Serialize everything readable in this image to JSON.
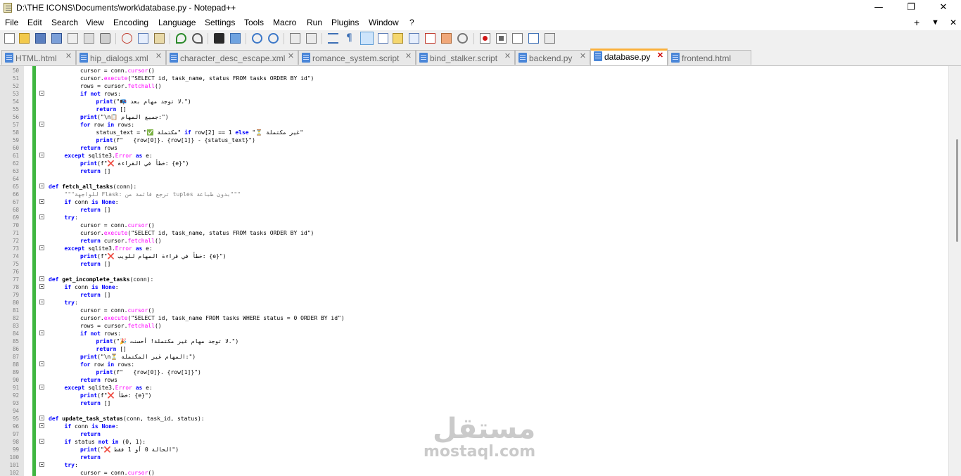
{
  "window": {
    "title": "D:\\THE ICONS\\Documents\\work\\database.py - Notepad++",
    "controls": {
      "minimize": "—",
      "maximize": "❐",
      "close": "✕"
    }
  },
  "menu": {
    "items": [
      "File",
      "Edit",
      "Search",
      "View",
      "Encoding",
      "Language",
      "Settings",
      "Tools",
      "Macro",
      "Run",
      "Plugins",
      "Window",
      "?"
    ],
    "right": {
      "plus": "+",
      "dropdown": "▼",
      "close": "✕"
    }
  },
  "toolbar": {
    "icons": [
      "new-file-icon",
      "open-file-icon",
      "save-icon",
      "save-all-icon",
      "close-icon",
      "close-all-icon",
      "print-icon",
      "cut-icon",
      "copy-icon",
      "paste-icon",
      "undo-icon",
      "redo-icon",
      "find-icon",
      "replace-icon",
      "zoom-in-icon",
      "zoom-out-icon",
      "sync-vertical-icon",
      "sync-horizontal-icon",
      "word-wrap-icon",
      "show-all-chars-icon",
      "indent-guide-icon",
      "doc-map-icon",
      "function-list-icon",
      "folder-workspace-icon",
      "monitor-icon",
      "record-macro-icon",
      "stop-macro-icon",
      "play-macro-icon",
      "run-macro-multiple-icon",
      "save-macro-icon"
    ]
  },
  "tabs": [
    {
      "label": "HTML.html",
      "active": false
    },
    {
      "label": "hip_dialogs.xml",
      "active": false
    },
    {
      "label": "character_desc_escape.xml",
      "active": false
    },
    {
      "label": "romance_system.script",
      "active": false
    },
    {
      "label": "bind_stalker.script",
      "active": false
    },
    {
      "label": "backend.py",
      "active": false
    },
    {
      "label": "database.py",
      "active": true
    },
    {
      "label": "frontend.html",
      "active": false
    }
  ],
  "editor": {
    "lines": [
      {
        "n": "50",
        "fold": false,
        "indent": 2,
        "tokens": [
          [
            "",
            "cursor = conn."
          ],
          [
            "fn",
            "cursor"
          ],
          [
            "",
            "()"
          ]
        ]
      },
      {
        "n": "51",
        "fold": false,
        "indent": 2,
        "tokens": [
          [
            "",
            "cursor."
          ],
          [
            "fn",
            "execute"
          ],
          [
            "",
            "(\"SELECT id, task_name, status FROM tasks ORDER BY id\")"
          ]
        ]
      },
      {
        "n": "52",
        "fold": false,
        "indent": 2,
        "tokens": [
          [
            "",
            "rows = cursor."
          ],
          [
            "fn",
            "fetchall"
          ],
          [
            "",
            "()"
          ]
        ]
      },
      {
        "n": "53",
        "fold": true,
        "indent": 2,
        "tokens": [
          [
            "kw",
            "if not"
          ],
          [
            "",
            " rows:"
          ]
        ]
      },
      {
        "n": "54",
        "fold": false,
        "indent": 3,
        "tokens": [
          [
            "kw",
            "print"
          ],
          [
            "",
            "(\"📭 لا توجد مهام بعد.\")"
          ]
        ]
      },
      {
        "n": "55",
        "fold": false,
        "indent": 3,
        "tokens": [
          [
            "kw",
            "return"
          ],
          [
            "",
            " []"
          ]
        ]
      },
      {
        "n": "56",
        "fold": false,
        "indent": 2,
        "tokens": [
          [
            "kw",
            "print"
          ],
          [
            "",
            "(\"\\n📋 جميع المهام:\")"
          ]
        ]
      },
      {
        "n": "57",
        "fold": true,
        "indent": 2,
        "tokens": [
          [
            "kw",
            "for"
          ],
          [
            "",
            " row "
          ],
          [
            "kw",
            "in"
          ],
          [
            "",
            " rows:"
          ]
        ]
      },
      {
        "n": "58",
        "fold": false,
        "indent": 3,
        "tokens": [
          [
            "",
            "status_text = \"✅ مكتملة\" "
          ],
          [
            "kw",
            "if"
          ],
          [
            "",
            " row[2] == 1 "
          ],
          [
            "kw",
            "else"
          ],
          [
            "",
            " \"⏳ غير مكتملة\""
          ]
        ]
      },
      {
        "n": "59",
        "fold": false,
        "indent": 3,
        "tokens": [
          [
            "kw",
            "print"
          ],
          [
            "",
            "(f\"   {row[0]}. {row[1]} - {status_text}\")"
          ]
        ]
      },
      {
        "n": "60",
        "fold": false,
        "indent": 2,
        "tokens": [
          [
            "kw",
            "return"
          ],
          [
            "",
            " rows"
          ]
        ]
      },
      {
        "n": "61",
        "fold": true,
        "indent": 1,
        "tokens": [
          [
            "kw",
            "except"
          ],
          [
            "",
            " sqlite3."
          ],
          [
            "fn",
            "Error"
          ],
          [
            "",
            " "
          ],
          [
            "kw",
            "as"
          ],
          [
            "",
            " e:"
          ]
        ]
      },
      {
        "n": "62",
        "fold": false,
        "indent": 2,
        "tokens": [
          [
            "kw",
            "print"
          ],
          [
            "",
            "(f\"❌ خطأ في القراءة: {e}\")"
          ]
        ]
      },
      {
        "n": "63",
        "fold": false,
        "indent": 2,
        "tokens": [
          [
            "kw",
            "return"
          ],
          [
            "",
            " []"
          ]
        ]
      },
      {
        "n": "64",
        "fold": false,
        "indent": 0,
        "tokens": []
      },
      {
        "n": "65",
        "fold": true,
        "indent": 0,
        "tokens": [
          [
            "kw",
            "def"
          ],
          [
            "",
            " "
          ],
          [
            "fdef",
            "fetch_all_tasks"
          ],
          [
            "",
            "(conn):"
          ]
        ]
      },
      {
        "n": "66",
        "fold": false,
        "indent": 1,
        "tokens": [
          [
            "str",
            "\"\"\"للواجهة Flask: ترجع قائمة من tuples بدون طباعة\"\"\""
          ]
        ]
      },
      {
        "n": "67",
        "fold": true,
        "indent": 1,
        "tokens": [
          [
            "kw",
            "if"
          ],
          [
            "",
            " conn "
          ],
          [
            "kw",
            "is None"
          ],
          [
            "",
            ":"
          ]
        ]
      },
      {
        "n": "68",
        "fold": false,
        "indent": 2,
        "tokens": [
          [
            "kw",
            "return"
          ],
          [
            "",
            " []"
          ]
        ]
      },
      {
        "n": "69",
        "fold": true,
        "indent": 1,
        "tokens": [
          [
            "kw",
            "try"
          ],
          [
            "",
            ":"
          ]
        ]
      },
      {
        "n": "70",
        "fold": false,
        "indent": 2,
        "tokens": [
          [
            "",
            "cursor = conn."
          ],
          [
            "fn",
            "cursor"
          ],
          [
            "",
            "()"
          ]
        ]
      },
      {
        "n": "71",
        "fold": false,
        "indent": 2,
        "tokens": [
          [
            "",
            "cursor."
          ],
          [
            "fn",
            "execute"
          ],
          [
            "",
            "(\"SELECT id, task_name, status FROM tasks ORDER BY id\")"
          ]
        ]
      },
      {
        "n": "72",
        "fold": false,
        "indent": 2,
        "tokens": [
          [
            "kw",
            "return"
          ],
          [
            "",
            " cursor."
          ],
          [
            "fn",
            "fetchall"
          ],
          [
            "",
            "()"
          ]
        ]
      },
      {
        "n": "73",
        "fold": true,
        "indent": 1,
        "tokens": [
          [
            "kw",
            "except"
          ],
          [
            "",
            " sqlite3."
          ],
          [
            "fn",
            "Error"
          ],
          [
            "",
            " "
          ],
          [
            "kw",
            "as"
          ],
          [
            "",
            " e:"
          ]
        ]
      },
      {
        "n": "74",
        "fold": false,
        "indent": 2,
        "tokens": [
          [
            "kw",
            "print"
          ],
          [
            "",
            "(f\"❌ خطأ في قراءة المهام للويب: {e}\")"
          ]
        ]
      },
      {
        "n": "75",
        "fold": false,
        "indent": 2,
        "tokens": [
          [
            "kw",
            "return"
          ],
          [
            "",
            " []"
          ]
        ]
      },
      {
        "n": "76",
        "fold": false,
        "indent": 0,
        "tokens": []
      },
      {
        "n": "77",
        "fold": true,
        "indent": 0,
        "tokens": [
          [
            "kw",
            "def"
          ],
          [
            "",
            " "
          ],
          [
            "fdef",
            "get_incomplete_tasks"
          ],
          [
            "",
            "(conn):"
          ]
        ]
      },
      {
        "n": "78",
        "fold": true,
        "indent": 1,
        "tokens": [
          [
            "kw",
            "if"
          ],
          [
            "",
            " conn "
          ],
          [
            "kw",
            "is None"
          ],
          [
            "",
            ":"
          ]
        ]
      },
      {
        "n": "79",
        "fold": false,
        "indent": 2,
        "tokens": [
          [
            "kw",
            "return"
          ],
          [
            "",
            " []"
          ]
        ]
      },
      {
        "n": "80",
        "fold": true,
        "indent": 1,
        "tokens": [
          [
            "kw",
            "try"
          ],
          [
            "",
            ":"
          ]
        ]
      },
      {
        "n": "81",
        "fold": false,
        "indent": 2,
        "tokens": [
          [
            "",
            "cursor = conn."
          ],
          [
            "fn",
            "cursor"
          ],
          [
            "",
            "()"
          ]
        ]
      },
      {
        "n": "82",
        "fold": false,
        "indent": 2,
        "tokens": [
          [
            "",
            "cursor."
          ],
          [
            "fn",
            "execute"
          ],
          [
            "",
            "(\"SELECT id, task_name FROM tasks WHERE status = 0 ORDER BY id\")"
          ]
        ]
      },
      {
        "n": "83",
        "fold": false,
        "indent": 2,
        "tokens": [
          [
            "",
            "rows = cursor."
          ],
          [
            "fn",
            "fetchall"
          ],
          [
            "",
            "()"
          ]
        ]
      },
      {
        "n": "84",
        "fold": true,
        "indent": 2,
        "tokens": [
          [
            "kw",
            "if not"
          ],
          [
            "",
            " rows:"
          ]
        ]
      },
      {
        "n": "85",
        "fold": false,
        "indent": 3,
        "tokens": [
          [
            "kw",
            "print"
          ],
          [
            "",
            "(\"🎉 لا توجد مهام غير مكتملة! أحسنت.\")"
          ]
        ]
      },
      {
        "n": "86",
        "fold": false,
        "indent": 3,
        "tokens": [
          [
            "kw",
            "return"
          ],
          [
            "",
            " []"
          ]
        ]
      },
      {
        "n": "87",
        "fold": false,
        "indent": 2,
        "tokens": [
          [
            "kw",
            "print"
          ],
          [
            "",
            "(\"\\n⏳ المهام غير المكتملة:\")"
          ]
        ]
      },
      {
        "n": "88",
        "fold": true,
        "indent": 2,
        "tokens": [
          [
            "kw",
            "for"
          ],
          [
            "",
            " row "
          ],
          [
            "kw",
            "in"
          ],
          [
            "",
            " rows:"
          ]
        ]
      },
      {
        "n": "89",
        "fold": false,
        "indent": 3,
        "tokens": [
          [
            "kw",
            "print"
          ],
          [
            "",
            "(f\"   {row[0]}. {row[1]}\")"
          ]
        ]
      },
      {
        "n": "90",
        "fold": false,
        "indent": 2,
        "tokens": [
          [
            "kw",
            "return"
          ],
          [
            "",
            " rows"
          ]
        ]
      },
      {
        "n": "91",
        "fold": true,
        "indent": 1,
        "tokens": [
          [
            "kw",
            "except"
          ],
          [
            "",
            " sqlite3."
          ],
          [
            "fn",
            "Error"
          ],
          [
            "",
            " "
          ],
          [
            "kw",
            "as"
          ],
          [
            "",
            " e:"
          ]
        ]
      },
      {
        "n": "92",
        "fold": false,
        "indent": 2,
        "tokens": [
          [
            "kw",
            "print"
          ],
          [
            "",
            "(f\"❌ خطأ: {e}\")"
          ]
        ]
      },
      {
        "n": "93",
        "fold": false,
        "indent": 2,
        "tokens": [
          [
            "kw",
            "return"
          ],
          [
            "",
            " []"
          ]
        ]
      },
      {
        "n": "94",
        "fold": false,
        "indent": 0,
        "tokens": []
      },
      {
        "n": "95",
        "fold": true,
        "indent": 0,
        "tokens": [
          [
            "kw",
            "def"
          ],
          [
            "",
            " "
          ],
          [
            "fdef",
            "update_task_status"
          ],
          [
            "",
            "(conn, task_id, status):"
          ]
        ]
      },
      {
        "n": "96",
        "fold": true,
        "indent": 1,
        "tokens": [
          [
            "kw",
            "if"
          ],
          [
            "",
            " conn "
          ],
          [
            "kw",
            "is None"
          ],
          [
            "",
            ":"
          ]
        ]
      },
      {
        "n": "97",
        "fold": false,
        "indent": 2,
        "tokens": [
          [
            "kw",
            "return"
          ]
        ]
      },
      {
        "n": "98",
        "fold": true,
        "indent": 1,
        "tokens": [
          [
            "kw",
            "if"
          ],
          [
            "",
            " status "
          ],
          [
            "kw",
            "not in"
          ],
          [
            "",
            " (0, 1):"
          ]
        ]
      },
      {
        "n": "99",
        "fold": false,
        "indent": 2,
        "tokens": [
          [
            "kw",
            "print"
          ],
          [
            "",
            "(\"❌ الحالة 0 أو 1 فقط\")"
          ]
        ]
      },
      {
        "n": "100",
        "fold": false,
        "indent": 2,
        "tokens": [
          [
            "kw",
            "return"
          ]
        ]
      },
      {
        "n": "101",
        "fold": true,
        "indent": 1,
        "tokens": [
          [
            "kw",
            "try"
          ],
          [
            "",
            ":"
          ]
        ]
      },
      {
        "n": "102",
        "fold": false,
        "indent": 2,
        "tokens": [
          [
            "",
            "cursor = conn."
          ],
          [
            "fn",
            "cursor"
          ],
          [
            "",
            "()"
          ]
        ]
      }
    ]
  },
  "watermark": {
    "arabic": "مستقل",
    "latin": "mostaql.com"
  }
}
